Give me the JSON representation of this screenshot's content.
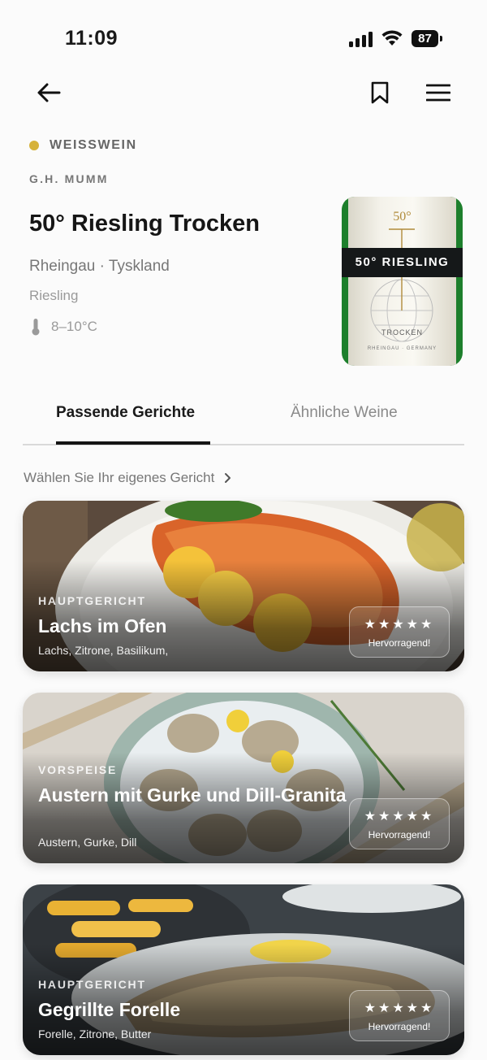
{
  "status": {
    "time": "11:09",
    "battery": "87"
  },
  "wine": {
    "category": "WEISSWEIN",
    "category_color": "#d6b23a",
    "producer": "G.H. MUMM",
    "name": "50° Riesling Trocken",
    "origin": "Rheingau · Tyskland",
    "grape": "Riesling",
    "temperature": "8–10°C",
    "label_year": "50°",
    "label_band": "50° RIESLING",
    "label_sub": "TROCKEN",
    "label_sub2": "RHEINGAU · GERMANY"
  },
  "tabs": [
    {
      "label": "Passende Gerichte",
      "active": true
    },
    {
      "label": "Ähnliche Weine",
      "active": false
    }
  ],
  "choose_label": "Wählen Sie Ihr eigenes Gericht",
  "dishes": [
    {
      "category": "HAUPTGERICHT",
      "title": "Lachs im Ofen",
      "ingredients": "Lachs, Zitrone, Basilikum,",
      "stars": "★★★★★",
      "rating_label": "Hervorragend!"
    },
    {
      "category": "VORSPEISE",
      "title": "Austern mit Gurke und Dill-Granita",
      "ingredients": "Austern, Gurke, Dill",
      "stars": "★★★★★",
      "rating_label": "Hervorragend!"
    },
    {
      "category": "HAUPTGERICHT",
      "title": "Gegrillte Forelle",
      "ingredients": "Forelle, Zitrone, Butter",
      "stars": "★★★★★",
      "rating_label": "Hervorragend!"
    }
  ]
}
